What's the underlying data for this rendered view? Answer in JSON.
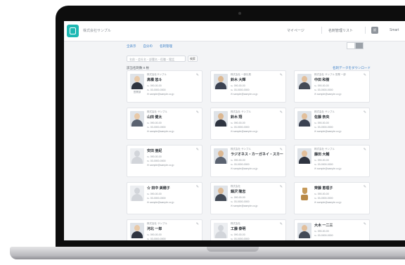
{
  "header": {
    "company": "株式会社サンプル",
    "links": [
      "マイページ",
      "名刺管理リスト"
    ],
    "badge": "設",
    "user": "Smart"
  },
  "tabs": [
    "全表示",
    "自分の",
    "名刺管理"
  ],
  "search": {
    "placeholder": "名前・会社名・部署名・役職・電話",
    "button": "検索"
  },
  "count_label": "該当名刺数 0 枚",
  "export_label": "名刺データをダウンロード",
  "colors": {
    "accent": "#1fb8b3",
    "link": "#3a7fc8"
  },
  "cards": [
    {
      "company": "株式会社サンプル",
      "name": "高橋 悠斗",
      "tag": "営業部",
      "phone": "℡ 090-00-00",
      "fax": "℡ 03-0000-0000",
      "email": "✉ sample@sample.co.jp",
      "photo": "person-1"
    },
    {
      "company": "株式会社 一部社員",
      "name": "鈴木 大輝",
      "tag": "",
      "phone": "℡ 090-00-00",
      "fax": "℡ 03-0000-0000",
      "email": "✉ sample@sample.co.jp",
      "photo": "person-2"
    },
    {
      "company": "株式会社 サンプル 営業 一部",
      "name": "中田 和樹",
      "tag": "",
      "phone": "℡ 090-00-00",
      "fax": "℡ 03-0000-0000",
      "email": "✉ sample@sample.co.jp",
      "photo": "person-3"
    },
    {
      "company": "株式会社 サンプル",
      "name": "山田 健太",
      "tag": "",
      "phone": "℡ 090-00-00",
      "fax": "℡ 03-0000-0000",
      "email": "✉ sample@sample.co.jp",
      "photo": "person-4"
    },
    {
      "company": "株式会社 サンプル",
      "name": "鈴木 翔",
      "tag": "",
      "phone": "℡ 090-00-00",
      "fax": "℡ 03-0000-0000",
      "email": "✉ sample@sample.co.jp",
      "photo": "person-5"
    },
    {
      "company": "株式会社 サンプル",
      "name": "佐藤 奈央",
      "tag": "",
      "phone": "℡ 090-00-00",
      "fax": "℡ 03-0000-0000",
      "email": "✉ sample@sample.co.jp",
      "photo": "person-6"
    },
    {
      "company": "",
      "name": "安田 亜紀",
      "tag": "",
      "phone": "℡ 090-00-00",
      "fax": "℡ 03-0000-0000",
      "email": "✉ sample@sample.co.jp",
      "photo": "empty"
    },
    {
      "company": "株式会社 サンプル",
      "name": "ラジオネス・カーガネイ・スカー",
      "tag": "",
      "phone": "℡ 090-00-00",
      "fax": "℡ 03-0000-0000",
      "email": "✉ sample@sample.co.jp",
      "photo": "person-7"
    },
    {
      "company": "株式会社 サンプル",
      "name": "藤田 大輔",
      "tag": "",
      "phone": "℡ 090-00-00",
      "fax": "℡ 03-0000-0000",
      "email": "✉ sample@sample.co.jp",
      "photo": "person-8"
    },
    {
      "company": "",
      "name": "☆ 田中 美穂子",
      "tag": "",
      "phone": "℡ 090-00-00",
      "fax": "℡ 03-0000-0000",
      "email": "✉ sample@sample.co.jp",
      "photo": "empty"
    },
    {
      "company": "株式会社",
      "name": "鍋沢 隆志",
      "tag": "",
      "phone": "℡ 090-00-00",
      "fax": "℡ 03-0000-0000",
      "email": "✉ sample@sample.co.jp",
      "photo": "person-9"
    },
    {
      "company": "",
      "name": "齊藤 恵理子",
      "tag": "",
      "phone": "℡ 090-00-00",
      "fax": "℡ 03-0000-0000",
      "email": "✉ sample@sample.co.jp",
      "photo": "deer"
    },
    {
      "company": "株式会社 サンプル",
      "name": "河北 一郎",
      "tag": "",
      "phone": "℡ 090-00-00",
      "fax": "℡ 03-0000-0000",
      "email": "",
      "photo": "person-10"
    },
    {
      "company": "株式会社",
      "name": "工藤 泰明",
      "tag": "",
      "phone": "℡ 090-00-00",
      "fax": "℡ 03-0000-0000",
      "email": "",
      "photo": "empty"
    },
    {
      "company": "",
      "name": "大木 一二三",
      "tag": "",
      "phone": "℡ 090-00-00",
      "fax": "℡ 03-0000-0000",
      "email": "",
      "photo": "person-11"
    }
  ]
}
